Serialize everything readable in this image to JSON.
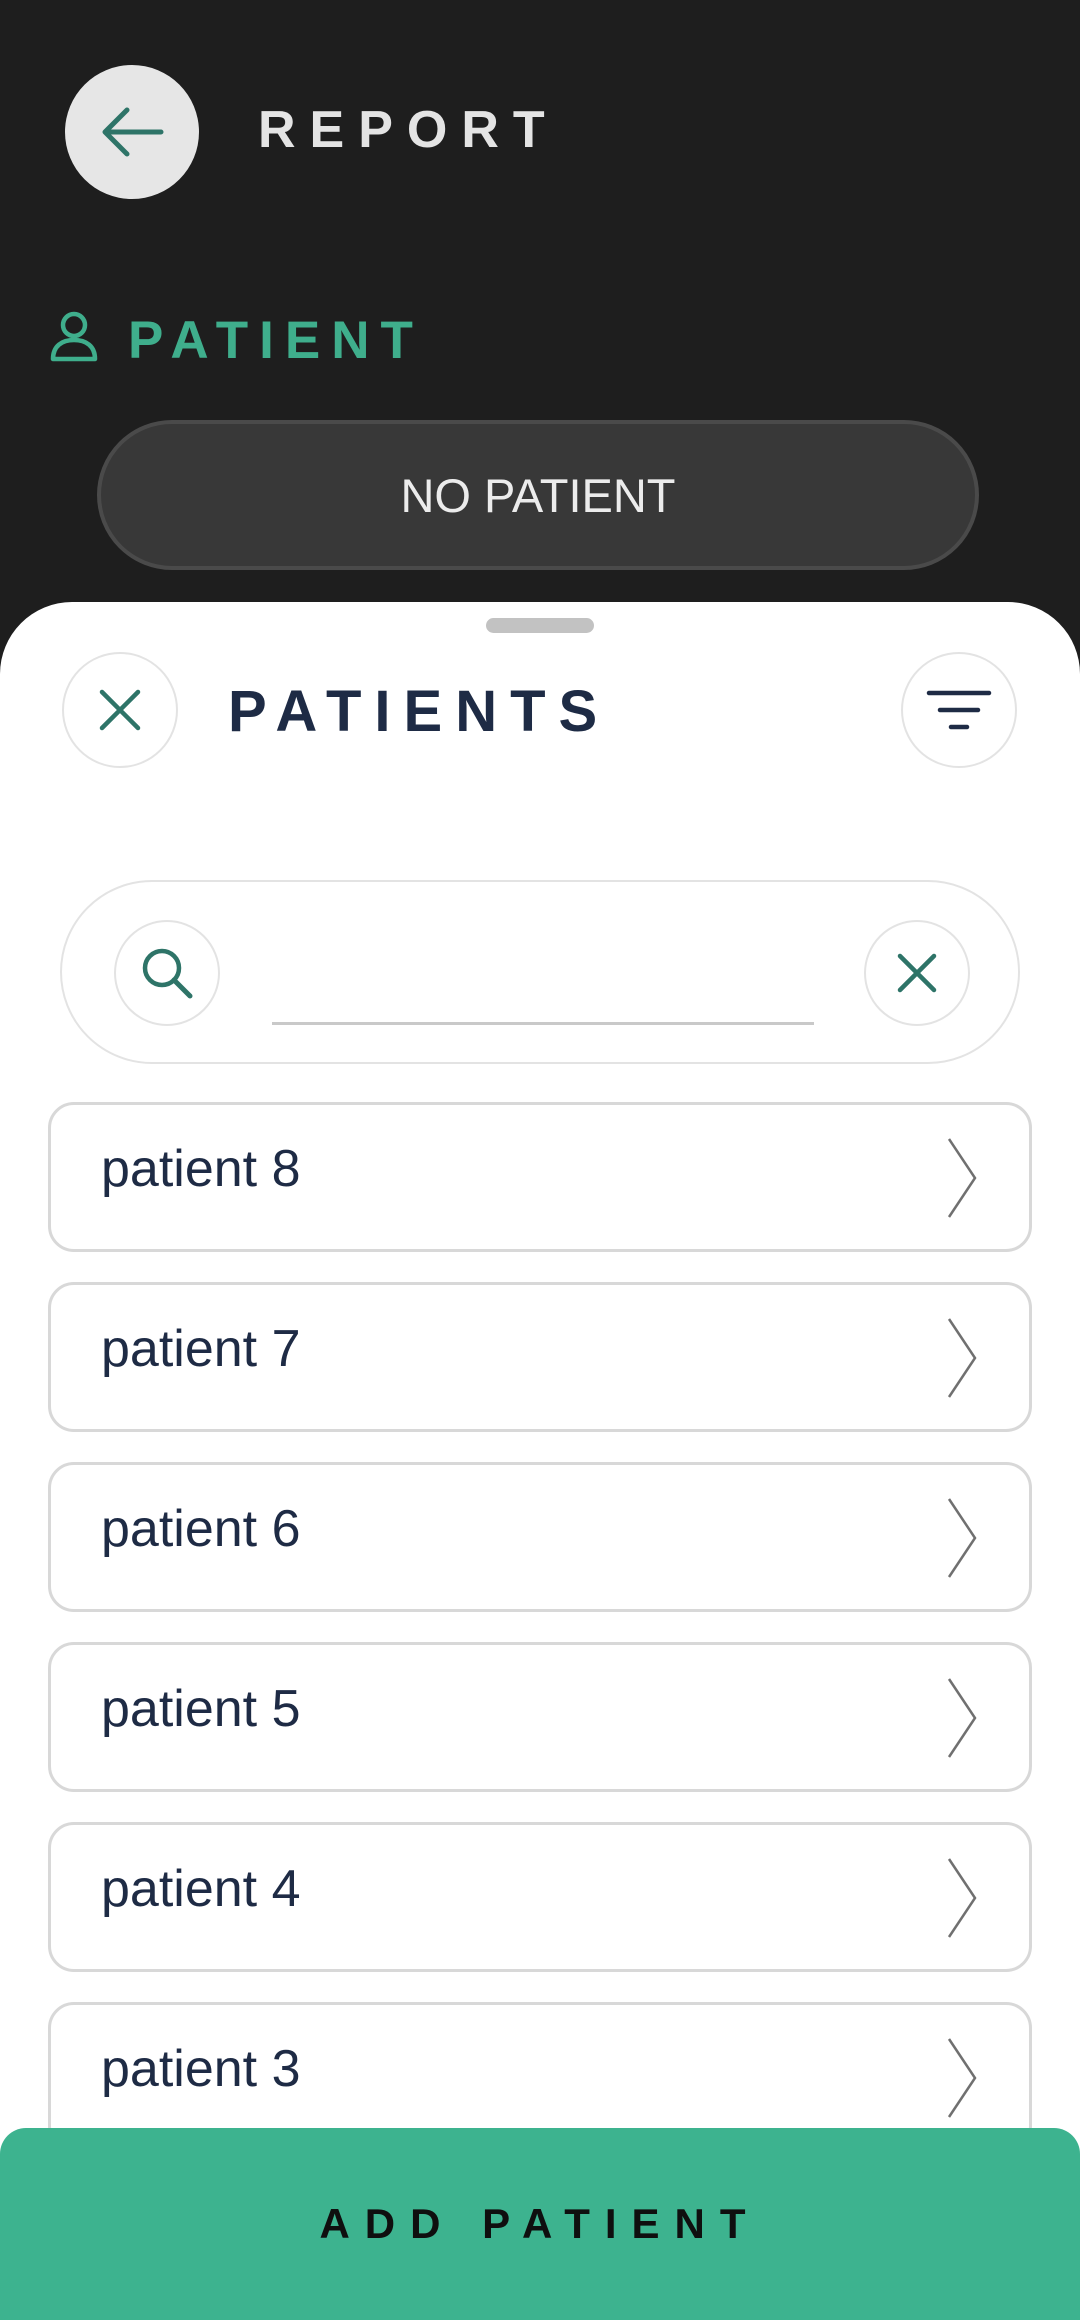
{
  "header": {
    "title": "REPORT"
  },
  "patient_section": {
    "label": "PATIENT",
    "selected_button_label": "NO PATIENT"
  },
  "sheet": {
    "title": "PATIENTS",
    "search": {
      "value": "",
      "placeholder": ""
    },
    "patients": [
      {
        "name": "patient 8"
      },
      {
        "name": "patient 7"
      },
      {
        "name": "patient 6"
      },
      {
        "name": "patient 5"
      },
      {
        "name": "patient 4"
      },
      {
        "name": "patient 3"
      }
    ],
    "add_button_label": "ADD PATIENT"
  },
  "icons": {
    "back": "arrow-left-icon",
    "patient": "user-icon",
    "close": "close-icon",
    "filter": "filter-icon",
    "search": "search-icon",
    "clear": "close-icon",
    "chevron": "chevron-right-icon"
  },
  "colors": {
    "background_dark": "#1e1e1e",
    "accent": "#3db38f",
    "icon_teal": "#2e7468",
    "text_navy": "#1e2b45"
  }
}
